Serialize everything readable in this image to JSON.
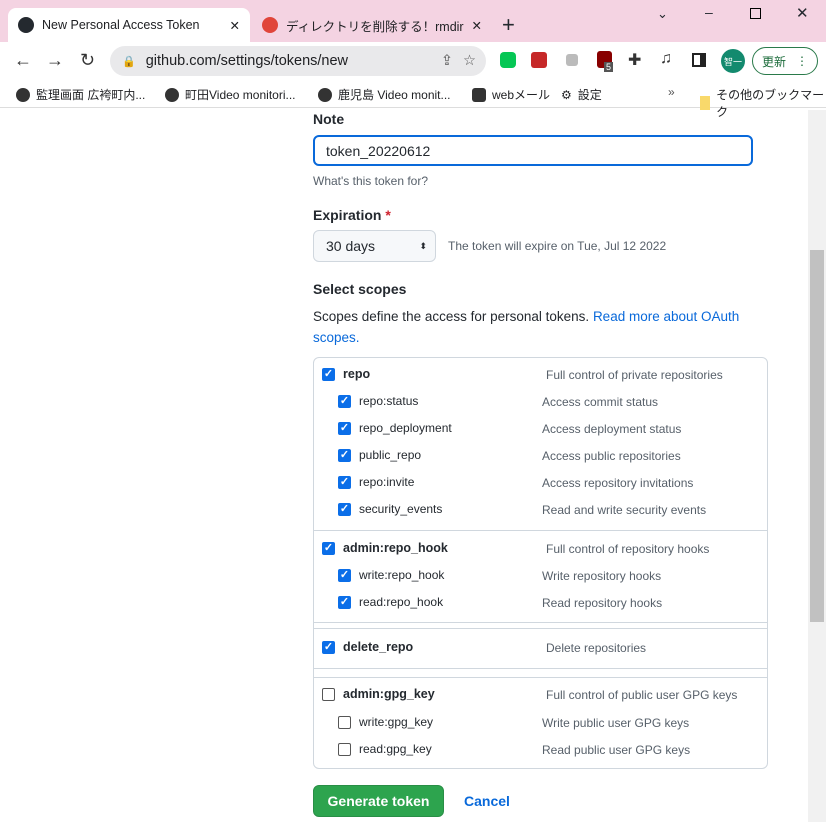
{
  "browser": {
    "tabs": [
      {
        "title": "New Personal Access Token"
      },
      {
        "title": "ディレクトリを削除する！rmdirコマン"
      }
    ],
    "url": "github.com/settings/tokens/new",
    "update_label": "更新",
    "profile": "智一",
    "ext_badge": "5",
    "bookmarks": [
      {
        "label": "監理画面 広袴町内..."
      },
      {
        "label": "町田Video monitori..."
      },
      {
        "label": "鹿児島 Video monit..."
      },
      {
        "label": "webメール"
      },
      {
        "label": "設定"
      }
    ],
    "other_bookmarks": "その他のブックマーク"
  },
  "form": {
    "note_label": "Note",
    "note_value": "token_20220612",
    "note_help": "What's this token for?",
    "expiration_label": "Expiration",
    "required_mark": "*",
    "expiration_value": "30 days",
    "expiration_help": "The token will expire on Tue, Jul 12 2022",
    "scopes_label": "Select scopes",
    "scopes_help": "Scopes define the access for personal tokens.",
    "scopes_link": "Read more about OAuth scopes.",
    "generate": "Generate token",
    "cancel": "Cancel"
  },
  "scopes": [
    {
      "name": "repo",
      "desc": "Full control of private repositories",
      "checked": true,
      "main": true
    },
    {
      "name": "repo:status",
      "desc": "Access commit status",
      "checked": true
    },
    {
      "name": "repo_deployment",
      "desc": "Access deployment status",
      "checked": true
    },
    {
      "name": "public_repo",
      "desc": "Access public repositories",
      "checked": true
    },
    {
      "name": "repo:invite",
      "desc": "Access repository invitations",
      "checked": true
    },
    {
      "name": "security_events",
      "desc": "Read and write security events",
      "checked": true
    },
    {
      "name": "admin:repo_hook",
      "desc": "Full control of repository hooks",
      "checked": true,
      "main": true
    },
    {
      "name": "write:repo_hook",
      "desc": "Write repository hooks",
      "checked": true
    },
    {
      "name": "read:repo_hook",
      "desc": "Read repository hooks",
      "checked": true
    },
    {
      "name": "delete_repo",
      "desc": "Delete repositories",
      "checked": true,
      "main": true
    },
    {
      "name": "admin:gpg_key",
      "desc": "Full control of public user GPG keys",
      "checked": false,
      "main": true
    },
    {
      "name": "write:gpg_key",
      "desc": "Write public user GPG keys",
      "checked": false
    },
    {
      "name": "read:gpg_key",
      "desc": "Read public user GPG keys",
      "checked": false
    }
  ],
  "colors": {
    "accent": "#0969da",
    "primary_button": "#2da44e",
    "tabbar": "#f4d3e2"
  }
}
